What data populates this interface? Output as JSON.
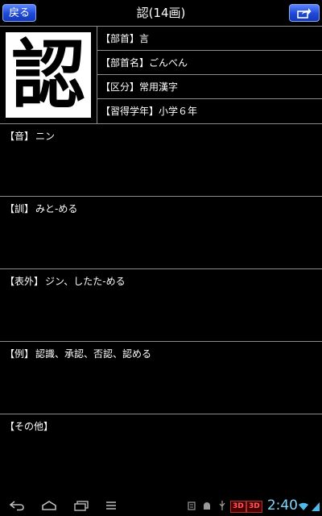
{
  "header": {
    "back_label": "戻る",
    "title": "認(14画)"
  },
  "kanji": {
    "character": "認"
  },
  "info": [
    {
      "label": "【部首】",
      "value": "言"
    },
    {
      "label": "【部首名】",
      "value": "ごんべん"
    },
    {
      "label": "【区分】",
      "value": "常用漢字"
    },
    {
      "label": "【習得学年】",
      "value": "小学６年"
    }
  ],
  "sections": [
    {
      "label": "【音】",
      "value": "ニン"
    },
    {
      "label": "【訓】",
      "value": "みと-める"
    },
    {
      "label": "【表外】",
      "value": "ジン、したた-める"
    },
    {
      "label": "【例】",
      "value": "認識、承認、否認、認める"
    },
    {
      "label": "【その他】",
      "value": ""
    }
  ],
  "statusbar": {
    "clock": "2:40",
    "badge1": "3D",
    "badge2": "3D"
  },
  "colors": {
    "button_blue": "#1f48d6",
    "clock": "#7fd7ff"
  }
}
